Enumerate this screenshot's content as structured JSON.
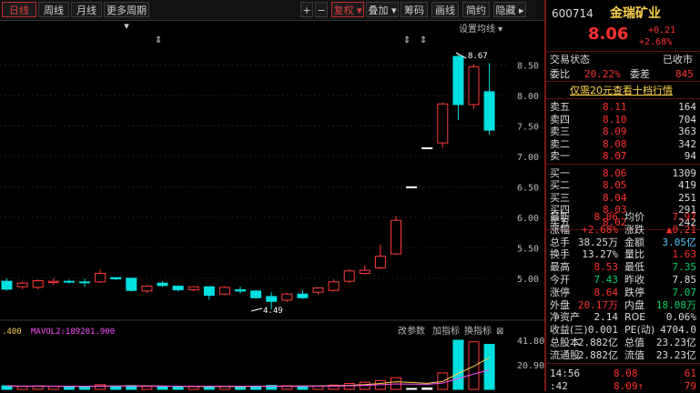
{
  "toolbar": {
    "tabs": [
      "日线",
      "周线",
      "月线",
      "更多周期 ▾"
    ],
    "zoom_plus": "+",
    "zoom_minus": "−",
    "fuquan": "复权 ▾",
    "overlay": "叠加 ▾",
    "chouma": "筹码",
    "huaxian": "画线",
    "jianjue": "简约",
    "hide": "隐藏 ▸"
  },
  "chart": {
    "ma_settings_label": "设置均线 ▾",
    "y_labels": [
      "8.50",
      "8.00",
      "7.50",
      "7.00",
      "6.50",
      "6.00",
      "5.50",
      "5.00"
    ],
    "high_marker": "8.67",
    "low_marker": "4.49",
    "volume_legend_left": ".400",
    "volume_legend_ma": "MAVOL2:189201.900",
    "volume_tools": [
      "改参数",
      "加指标",
      "换指标",
      "⊠"
    ],
    "volume_y_labels": [
      "41.80",
      "20.90"
    ],
    "colors": {
      "up": "#ff3b3b",
      "down": "#00e0e0",
      "flat": "#ffffff",
      "ma": "#ffd34a",
      "ma2": "#ff4dff"
    }
  },
  "chart_data": {
    "type": "candlestick",
    "ylim": [
      4.49,
      8.67
    ],
    "candles": [
      {
        "o": 4.95,
        "h": 5.0,
        "l": 4.8,
        "c": 4.82
      },
      {
        "o": 4.86,
        "h": 4.95,
        "l": 4.82,
        "c": 4.92
      },
      {
        "o": 4.85,
        "h": 4.98,
        "l": 4.82,
        "c": 4.96
      },
      {
        "o": 4.93,
        "h": 5.0,
        "l": 4.89,
        "c": 4.95
      },
      {
        "o": 4.95,
        "h": 4.98,
        "l": 4.91,
        "c": 4.94
      },
      {
        "o": 4.94,
        "h": 4.99,
        "l": 4.86,
        "c": 4.93
      },
      {
        "o": 4.94,
        "h": 5.15,
        "l": 4.92,
        "c": 5.08
      },
      {
        "o": 5.01,
        "h": 5.02,
        "l": 4.97,
        "c": 4.99
      },
      {
        "o": 5.0,
        "h": 5.01,
        "l": 4.78,
        "c": 4.8
      },
      {
        "o": 4.79,
        "h": 4.89,
        "l": 4.76,
        "c": 4.87
      },
      {
        "o": 4.92,
        "h": 4.95,
        "l": 4.86,
        "c": 4.88
      },
      {
        "o": 4.87,
        "h": 4.88,
        "l": 4.78,
        "c": 4.81
      },
      {
        "o": 4.81,
        "h": 4.87,
        "l": 4.78,
        "c": 4.86
      },
      {
        "o": 4.86,
        "h": 4.87,
        "l": 4.65,
        "c": 4.72
      },
      {
        "o": 4.74,
        "h": 4.87,
        "l": 4.72,
        "c": 4.85
      },
      {
        "o": 4.81,
        "h": 4.86,
        "l": 4.75,
        "c": 4.79
      },
      {
        "o": 4.79,
        "h": 4.81,
        "l": 4.67,
        "c": 4.68
      },
      {
        "o": 4.7,
        "h": 4.77,
        "l": 4.49,
        "c": 4.62
      },
      {
        "o": 4.64,
        "h": 4.76,
        "l": 4.61,
        "c": 4.74
      },
      {
        "o": 4.74,
        "h": 4.81,
        "l": 4.66,
        "c": 4.68
      },
      {
        "o": 4.77,
        "h": 4.85,
        "l": 4.73,
        "c": 4.84
      },
      {
        "o": 4.8,
        "h": 4.98,
        "l": 4.78,
        "c": 4.94
      },
      {
        "o": 4.95,
        "h": 5.15,
        "l": 4.92,
        "c": 5.12
      },
      {
        "o": 5.08,
        "h": 5.21,
        "l": 5.06,
        "c": 5.13
      },
      {
        "o": 5.17,
        "h": 5.55,
        "l": 5.15,
        "c": 5.36
      },
      {
        "o": 5.4,
        "h": 6.02,
        "l": 5.38,
        "c": 5.95
      },
      {
        "o": 6.5,
        "h": 6.5,
        "l": 6.5,
        "c": 6.5
      },
      {
        "o": 7.14,
        "h": 7.14,
        "l": 7.14,
        "c": 7.14
      },
      {
        "o": 7.22,
        "h": 7.88,
        "l": 7.14,
        "c": 7.86
      },
      {
        "o": 8.64,
        "h": 8.67,
        "l": 7.6,
        "c": 7.85
      },
      {
        "o": 7.85,
        "h": 8.51,
        "l": 7.78,
        "c": 8.47
      },
      {
        "o": 8.06,
        "h": 8.53,
        "l": 7.35,
        "c": 7.43
      }
    ],
    "volume": [
      3,
      2.5,
      2.8,
      2.6,
      2.4,
      2.2,
      4.0,
      2.8,
      3.2,
      2.5,
      2.2,
      2.4,
      2.3,
      2.6,
      2.4,
      2.5,
      2.8,
      3.4,
      3.0,
      2.6,
      2.8,
      3.6,
      5.0,
      6.1,
      7.5,
      10.0,
      0.8,
      1.2,
      14.0,
      41.8,
      40.5,
      38.25
    ]
  },
  "quote": {
    "code": "600714",
    "name": "金瑞矿业",
    "price": "8.06",
    "change": "+0.21",
    "change_pct": "+2.68%",
    "status_label": "交易状态",
    "status_value": "已收市",
    "weibi_label": "委比",
    "weibi_value": "20.22%",
    "weicha_label": "委差",
    "weicha_value": "845",
    "promo": "仅需20元查看十档行情",
    "asks": [
      {
        "label": "卖五",
        "price": "8.11",
        "vol": "164"
      },
      {
        "label": "卖四",
        "price": "8.10",
        "vol": "704"
      },
      {
        "label": "卖三",
        "price": "8.09",
        "vol": "363"
      },
      {
        "label": "卖二",
        "price": "8.08",
        "vol": "342"
      },
      {
        "label": "卖一",
        "price": "8.07",
        "vol": "94"
      }
    ],
    "bids": [
      {
        "label": "买一",
        "price": "8.06",
        "vol": "1309"
      },
      {
        "label": "买二",
        "price": "8.05",
        "vol": "419"
      },
      {
        "label": "买三",
        "price": "8.04",
        "vol": "251"
      },
      {
        "label": "买四",
        "price": "8.03",
        "vol": "291"
      },
      {
        "label": "买五",
        "price": "8.02",
        "vol": "242"
      }
    ],
    "stats": [
      {
        "l1": "最新",
        "v1": "8.06",
        "c1": "r",
        "l2": "均价",
        "v2": "7.97",
        "c2": "r"
      },
      {
        "l1": "涨幅",
        "v1": "+2.68%",
        "c1": "r",
        "l2": "涨跌",
        "v2": "▲0.21",
        "c2": "r"
      },
      {
        "l1": "总手",
        "v1": "38.25万",
        "c1": "w",
        "l2": "金额",
        "v2": "3.05亿",
        "c2": "c"
      },
      {
        "l1": "换手",
        "v1": "13.27%",
        "c1": "w",
        "l2": "量比",
        "v2": "1.63",
        "c2": "r"
      },
      {
        "l1": "最高",
        "v1": "8.53",
        "c1": "r",
        "l2": "最低",
        "v2": "7.35",
        "c2": "g"
      },
      {
        "l1": "今开",
        "v1": "7.43",
        "c1": "g",
        "l2": "昨收",
        "v2": "7.85",
        "c2": "w"
      },
      {
        "l1": "涨停",
        "v1": "8.64",
        "c1": "r",
        "l2": "跌停",
        "v2": "7.07",
        "c2": "g"
      },
      {
        "l1": "外盘",
        "v1": "20.17万",
        "c1": "r",
        "l2": "内盘",
        "v2": "18.08万",
        "c2": "g"
      },
      {
        "l1": "净资产",
        "v1": "2.14",
        "c1": "w",
        "l2": "ROE",
        "v2": "0.06%",
        "c2": "w"
      },
      {
        "l1": "收益(三)",
        "v1": "0.001",
        "c1": "w",
        "l2": "PE(动)",
        "v2": "4704.0",
        "c2": "w"
      },
      {
        "l1": "总股本",
        "v1": "2.882亿",
        "c1": "w",
        "l2": "总值",
        "v2": "23.23亿",
        "c2": "w"
      },
      {
        "l1": "流通股",
        "v1": "2.882亿",
        "c1": "w",
        "l2": "流值",
        "v2": "23.23亿",
        "c2": "w"
      }
    ],
    "ticks": [
      {
        "time": "14:56",
        "price": "8.08",
        "vol": "61"
      },
      {
        "time": ":42",
        "price": "8.09↑",
        "vol": "79"
      }
    ]
  }
}
